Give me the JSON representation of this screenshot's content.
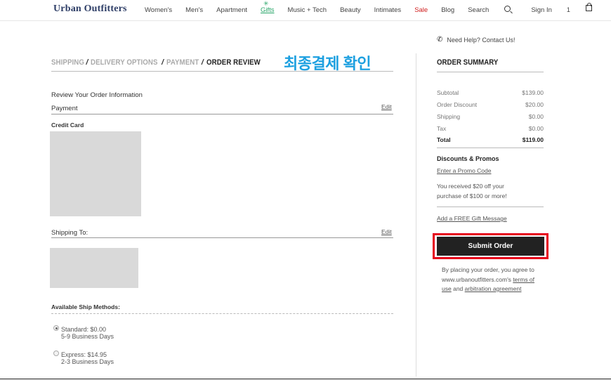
{
  "header": {
    "logo": "Urban Outfitters",
    "nav": [
      "Women's",
      "Men's",
      "Apartment",
      "Gifts",
      "Music + Tech",
      "Beauty",
      "Intimates",
      "Sale",
      "Blog"
    ],
    "search_label": "Search",
    "signin_label": "Sign In",
    "bag_count": "1"
  },
  "help": "Need Help? Contact Us!",
  "steps": {
    "shipping": "SHIPPING",
    "delivery": "DELIVERY OPTIONS",
    "payment": "PAYMENT",
    "review": "ORDER REVIEW",
    "separator": "/",
    "annotation_korean": "최종결제 확인"
  },
  "review": {
    "heading": "Review Your Order Information",
    "payment_label": "Payment",
    "edit_label": "Edit",
    "credit_card_label": "Credit Card",
    "shipping_to_label": "Shipping To:",
    "ship_methods_label": "Available Ship Methods:",
    "methods": [
      {
        "line1": "Standard: $0.00",
        "line2": "5-9 Business Days",
        "selected": true
      },
      {
        "line1": "Express: $14.95",
        "line2": "2-3 Business Days",
        "selected": false
      }
    ]
  },
  "summary": {
    "title": "ORDER SUMMARY",
    "rows": [
      {
        "label": "Subtotal",
        "value": "$139.00"
      },
      {
        "label": "Order Discount",
        "value": "$20.00"
      },
      {
        "label": "Shipping",
        "value": "$0.00"
      },
      {
        "label": "Tax",
        "value": "$0.00"
      }
    ],
    "total_label": "Total",
    "total_value": "$119.00",
    "promos_title": "Discounts & Promos",
    "promo_link": "Enter a Promo Code",
    "promo_msg_1": "You received $20 off your",
    "promo_msg_2": "purchase of $100 or more!",
    "gift_link": "Add a FREE Gift Message",
    "submit_label": "Submit Order",
    "agree_prefix": "By placing your order, you agree to www.urbanoutfitters.com's",
    "terms_link": "terms of use",
    "and": "and",
    "arbitration_link": "arbitration agreement"
  },
  "colors": {
    "brand": "#2d3d66",
    "gifts": "#2aa66a",
    "sale": "#d02020",
    "annotation": "#1da0e0",
    "highlight": "#e6001a",
    "button": "#222222"
  }
}
